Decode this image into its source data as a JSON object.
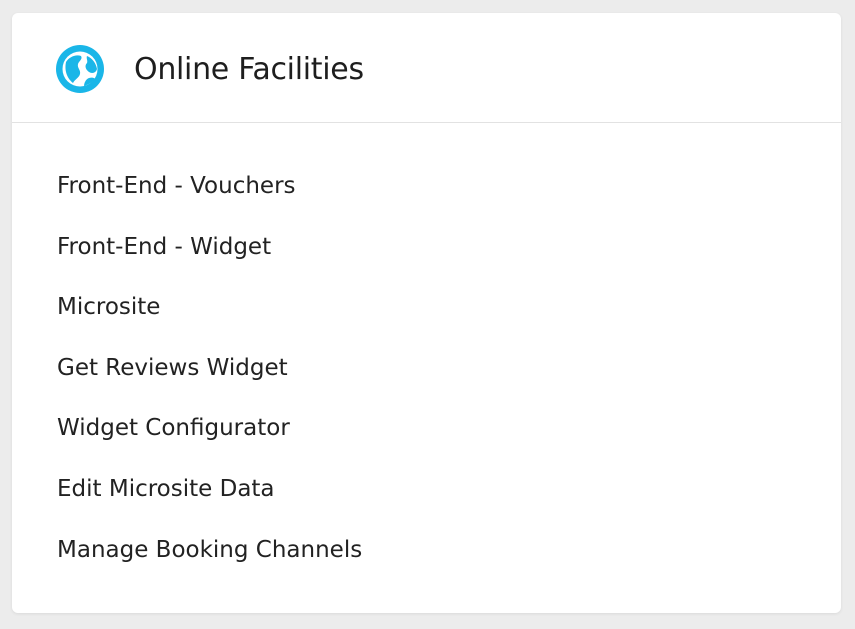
{
  "panel": {
    "title": "Online Facilities",
    "icon": "globe-icon",
    "accent_color": "#1ab6e8"
  },
  "links": [
    {
      "label": "Front-End - Vouchers"
    },
    {
      "label": "Front-End - Widget"
    },
    {
      "label": "Microsite"
    },
    {
      "label": "Get Reviews Widget"
    },
    {
      "label": "Widget Configurator"
    },
    {
      "label": "Edit Microsite Data"
    },
    {
      "label": "Manage Booking Channels"
    }
  ]
}
